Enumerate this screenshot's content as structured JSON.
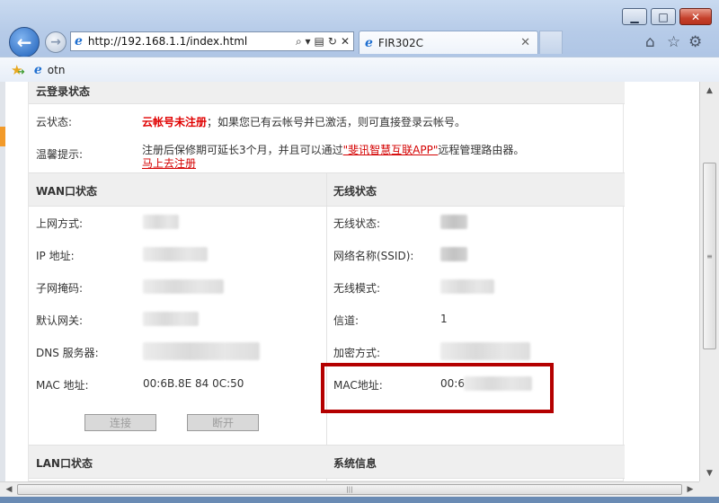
{
  "window": {
    "minimize_glyph": "▁",
    "maximize_glyph": "□",
    "close_glyph": "✕"
  },
  "nav": {
    "back_glyph": "←",
    "forward_glyph": "→"
  },
  "address_bar": {
    "url": "http://192.168.1.1/index.html",
    "search_glyph": "⌕ ▾",
    "compat_glyph": "▤",
    "refresh_glyph": "↻",
    "stop_glyph": "✕"
  },
  "tab": {
    "title": "FIR302C",
    "close_glyph": "✕"
  },
  "toolbar_icons": {
    "home": "⌂",
    "favorites": "☆",
    "tools": "⚙"
  },
  "favorites_bar": {
    "item_label": "otn"
  },
  "cloud": {
    "section_title": "云登录状态",
    "status_label": "云状态:",
    "status_value": "云帐号未注册",
    "status_desc": "；如果您已有云帐号并已激活，则可直接登录云帐号。",
    "tip_label": "温馨提示:",
    "tip_prefix": "注册后保修期可延长3个月，并且可以通过",
    "tip_app_link": "\"斐讯智慧互联APP\"",
    "tip_suffix": "远程管理路由器。",
    "register_link": "马上去注册"
  },
  "wan": {
    "section_title": "WAN口状态",
    "rows": [
      {
        "label": "上网方式:",
        "value": ""
      },
      {
        "label": "IP 地址:",
        "value": ""
      },
      {
        "label": "子网掩码:",
        "value": ""
      },
      {
        "label": "默认网关:",
        "value": ""
      },
      {
        "label": "DNS 服务器:",
        "value": ""
      },
      {
        "label": "MAC 地址:",
        "value": "00:6B.8E 84 0C:50"
      }
    ],
    "connect_button": "连接",
    "disconnect_button": "断开"
  },
  "wireless": {
    "section_title": "无线状态",
    "rows": [
      {
        "label": "无线状态:",
        "value": ""
      },
      {
        "label": "网络名称(SSID):",
        "value": ""
      },
      {
        "label": "无线模式:",
        "value": ""
      },
      {
        "label": "信道:",
        "value": "1"
      },
      {
        "label": "加密方式:",
        "value": ""
      },
      {
        "label": "MAC地址:",
        "value": "00:6"
      }
    ]
  },
  "lan": {
    "section_title": "LAN口状态"
  },
  "system": {
    "section_title": "系统信息"
  },
  "scrollbar": {
    "up_glyph": "▲",
    "down_glyph": "▼",
    "left_glyph": "◀",
    "right_glyph": "▶",
    "grip_v": "≡",
    "grip_h": "|||"
  },
  "colors": {
    "accent_red": "#d40000",
    "highlight_box": "#b40000",
    "section_header_bg": "#efefef"
  }
}
